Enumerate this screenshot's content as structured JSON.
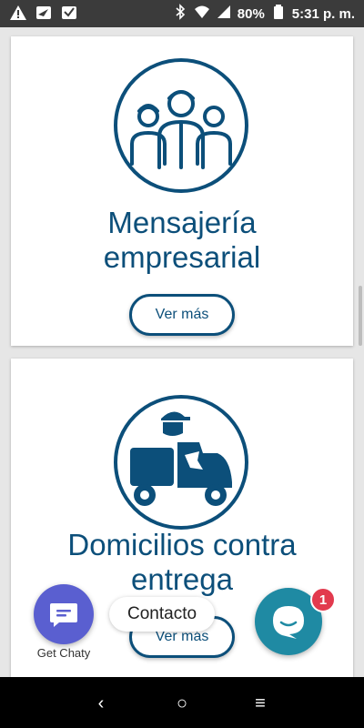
{
  "status_bar": {
    "battery": "80%",
    "time": "5:31 p. m.",
    "icons": [
      "warning-icon",
      "send-icon",
      "check-box-icon",
      "bluetooth-icon",
      "wifi-icon",
      "signal-icon",
      "battery-icon"
    ]
  },
  "cards": [
    {
      "title_line1": "Mensajería",
      "title_line2": "empresarial",
      "button": "Ver más",
      "icon": "team-people-icon"
    },
    {
      "title_line1": "Domicilios contra",
      "title_line2": "entrega",
      "button": "Ver más",
      "icon": "delivery-scooter-icon"
    }
  ],
  "chat": {
    "chaty_label": "Get Chaty",
    "contact_tooltip": "Contacto",
    "badge_count": "1"
  },
  "nav": {
    "back": "‹",
    "home": "○",
    "menu": "≡"
  },
  "colors": {
    "brand": "#0c4f7a",
    "chaty": "#5a5fd0",
    "chat": "#1f8aa3",
    "badge": "#e23a4e"
  }
}
